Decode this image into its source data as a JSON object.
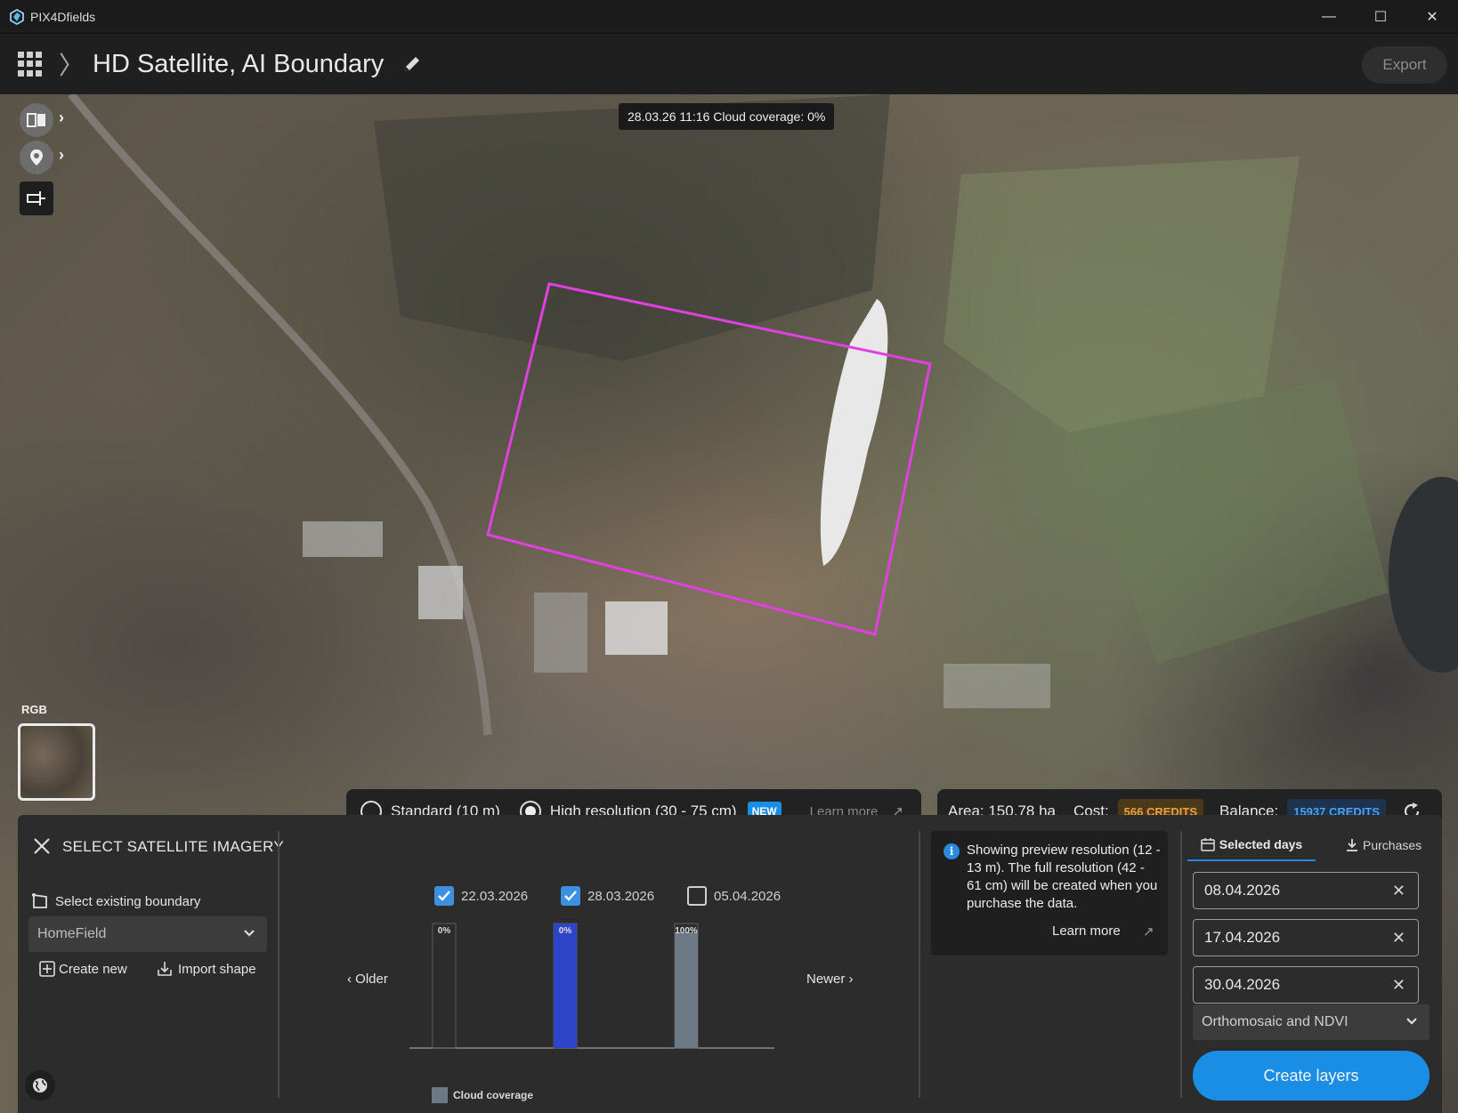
{
  "app": {
    "name": "PIX4Dfields"
  },
  "window_controls": {
    "minimize": "—",
    "maximize": "☐",
    "close": "✕"
  },
  "header": {
    "title": "HD Satellite, AI Boundary",
    "export_label": "Export"
  },
  "map": {
    "date_tooltip": "28.03.26 11:16 Cloud coverage: 0%",
    "layer_label": "RGB",
    "boundary_color": "#e040e0"
  },
  "resolution": {
    "standard_label": "Standard (10 m)",
    "high_label": "High resolution (30 - 75 cm)",
    "new_badge": "NEW",
    "learn_more": "Learn more",
    "selected": "high"
  },
  "cost": {
    "area_label": "Area: 150,78 ha",
    "cost_label": "Cost:",
    "cost_value": "566 CREDITS",
    "balance_label": "Balance:",
    "balance_value": "15937 CREDITS"
  },
  "selection_panel": {
    "title": "SELECT SATELLITE IMAGERY",
    "existing_label": "Select existing boundary",
    "boundary_value": "HomeField",
    "create_new": "Create new",
    "import_shape": "Import shape"
  },
  "timeline": {
    "older": "Older",
    "newer": "Newer",
    "dates": [
      {
        "label": "22.03.2026",
        "checked": true
      },
      {
        "label": "28.03.2026",
        "checked": true
      },
      {
        "label": "05.04.2026",
        "checked": false
      }
    ],
    "legend": "Cloud coverage"
  },
  "chart_data": {
    "type": "bar",
    "categories": [
      "22.03.2026",
      "28.03.2026",
      "05.04.2026"
    ],
    "values": [
      0,
      0,
      100
    ],
    "value_labels": [
      "0%",
      "0%",
      "100%"
    ],
    "ylim": [
      0,
      100
    ],
    "series_colors": {
      "selected": "#2f45c8",
      "normal": "#6e7986"
    },
    "selected_index": 1
  },
  "info": {
    "text": "Showing preview resolution (12 - 13 m). The full resolution (42 - 61 cm) will be created when you purchase the data.",
    "learn_more": "Learn more"
  },
  "right_panel": {
    "tab_selected": "Selected days",
    "tab_purchases": "Purchases",
    "selected_days": [
      "08.04.2026",
      "17.04.2026",
      "30.04.2026"
    ],
    "output_value": "Orthomosaic and NDVI",
    "create_button": "Create layers"
  }
}
